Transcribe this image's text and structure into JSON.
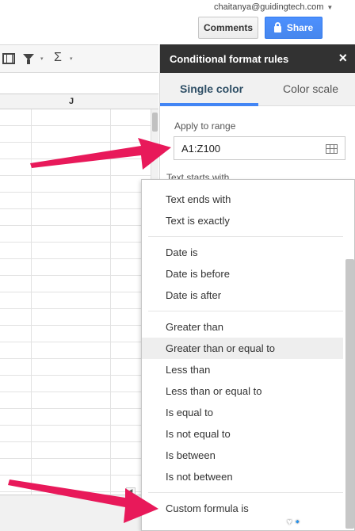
{
  "header": {
    "account_email": "chaitanya@guidingtech.com",
    "comments_label": "Comments",
    "share_label": "Share"
  },
  "toolbar": {
    "sigma": "Σ",
    "caret": "▾"
  },
  "sheet": {
    "column_label": "J"
  },
  "panel": {
    "title": "Conditional format rules",
    "close": "×",
    "tabs": [
      "Single color",
      "Color scale"
    ],
    "active_tab": "Single color",
    "apply_label": "Apply to range",
    "range_value": "A1:Z100",
    "partial_text": "Text starts with"
  },
  "menu": {
    "items": [
      "Text ends with",
      "Text is exactly",
      "Date is",
      "Date is before",
      "Date is after",
      "Greater than",
      "Greater than or equal to",
      "Less than",
      "Less than or equal to",
      "Is equal to",
      "Is not equal to",
      "Is between",
      "Is not between",
      "Custom formula is"
    ],
    "highlighted": "Greater than or equal to"
  },
  "watermark": "♥​🔹",
  "colors": {
    "panel_header": "#323232",
    "accent": "#4285f4",
    "share_button": "#4d90fe",
    "arrow": "#e8195a"
  },
  "icons": [
    "select-all-icon",
    "filter-icon",
    "sigma-icon",
    "lock-icon",
    "close-icon",
    "range-grid-icon"
  ]
}
